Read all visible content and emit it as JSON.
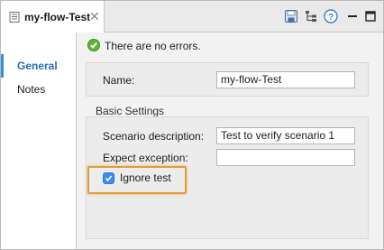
{
  "tab": {
    "title": "my-flow-Test",
    "close_glyph": "✕",
    "icon": "document-icon"
  },
  "toolbar": {
    "icons": [
      "save-icon",
      "tree-icon",
      "help-icon",
      "minimize-icon",
      "maximize-icon"
    ],
    "help_glyph": "?"
  },
  "nav": {
    "items": [
      {
        "label": "General",
        "active": true
      },
      {
        "label": "Notes",
        "active": false
      }
    ]
  },
  "status": {
    "icon": "check-circle-icon",
    "text": "There are no errors."
  },
  "general": {
    "name_label": "Name:",
    "name_value": "my-flow-Test"
  },
  "basic_settings": {
    "section_title": "Basic Settings",
    "scenario_label": "Scenario description:",
    "scenario_value": "Test to verify scenario 1",
    "exception_label": "Expect exception:",
    "exception_value": "",
    "ignore_label": "Ignore test",
    "ignore_checked": true
  },
  "colors": {
    "accent": "#3b8cd8",
    "highlight": "#e49a37",
    "success": "#5fb534",
    "checkbox": "#3d8ef0"
  }
}
